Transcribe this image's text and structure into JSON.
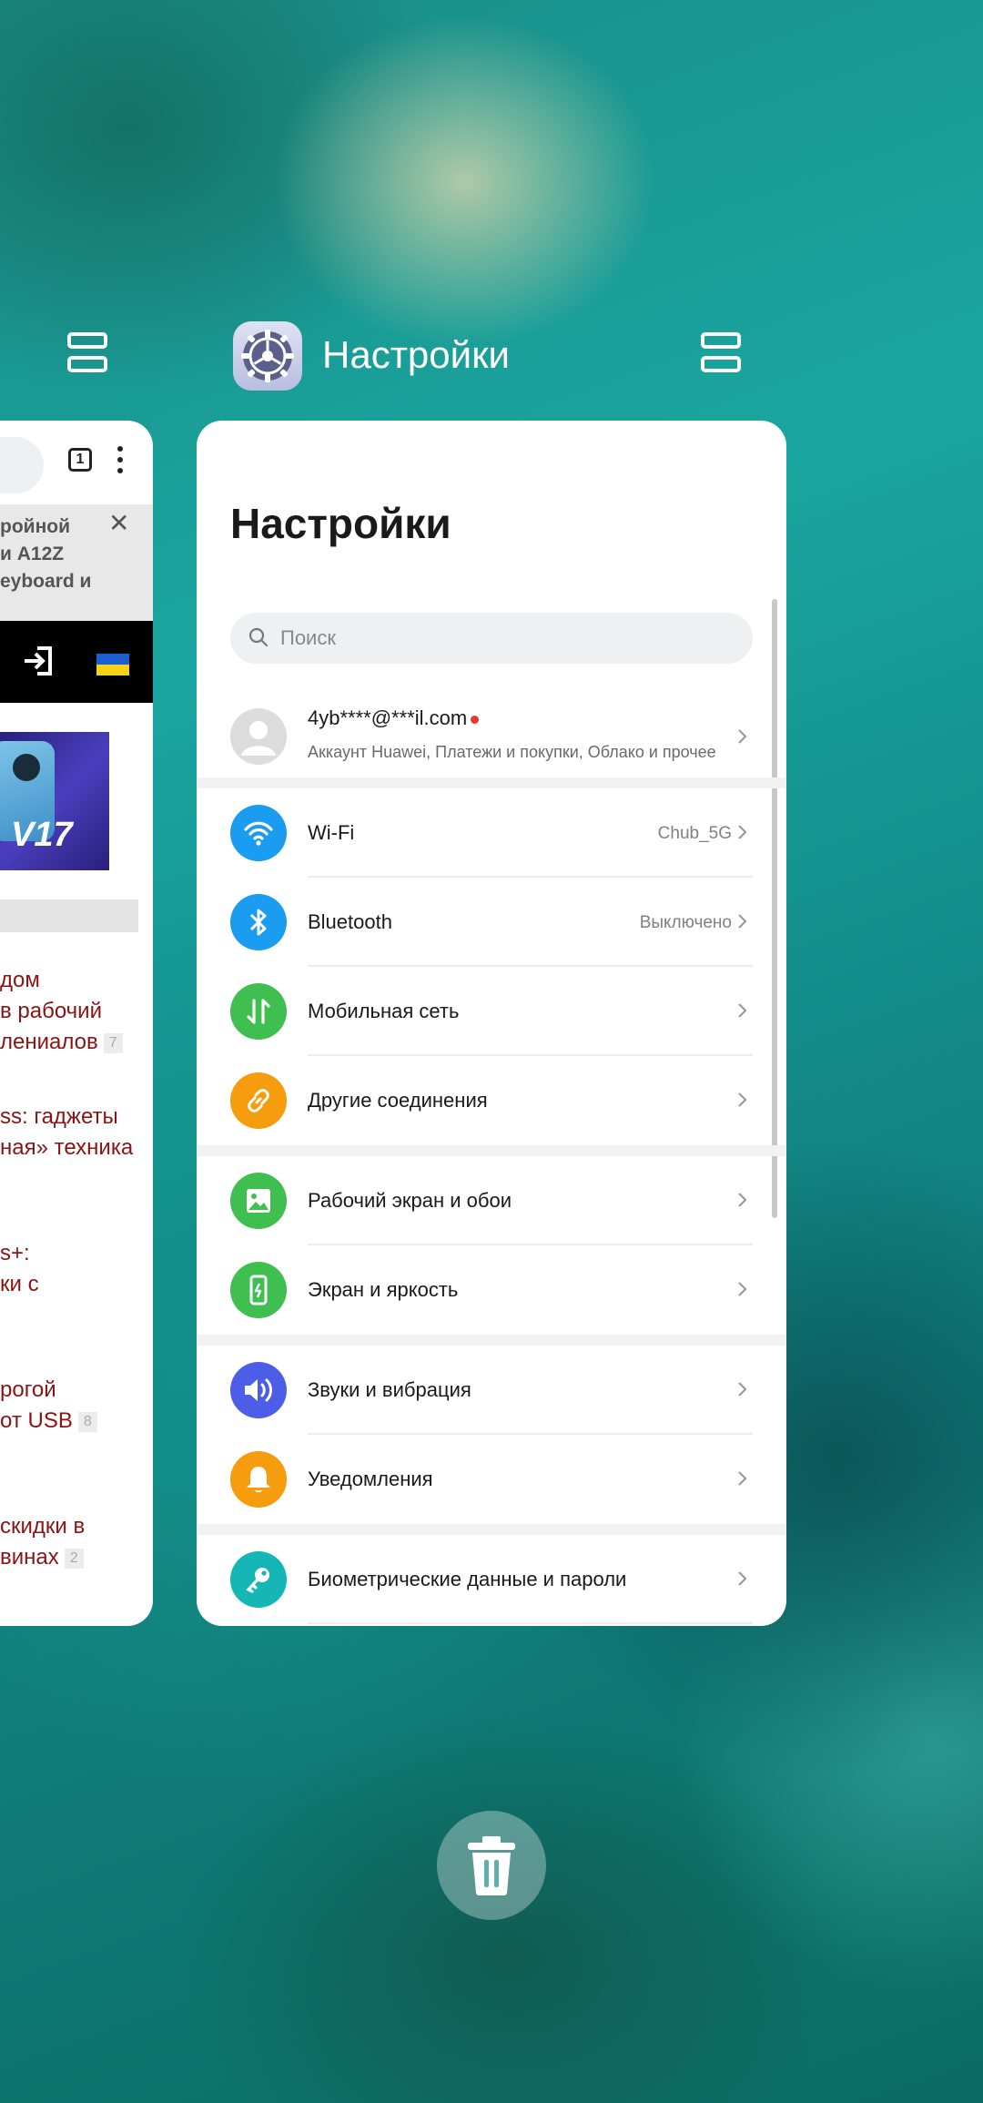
{
  "header": {
    "app_title": "Настройки"
  },
  "browser_card": {
    "tab_count": "1",
    "banner_lines": [
      "ройной",
      "и A12Z",
      "eyboard и"
    ],
    "phone_promo_text": "V17",
    "links": [
      {
        "lines": [
          "дом",
          "в рабочий",
          "лениалов"
        ],
        "count": "7"
      },
      {
        "lines": [
          "ss: гаджеты",
          "ная» техника"
        ],
        "count": ""
      },
      {
        "lines": [
          "s+:",
          "ки с"
        ],
        "count": ""
      },
      {
        "lines": [
          "рогой",
          "от USB"
        ],
        "count": "8"
      },
      {
        "lines": [
          "скидки в",
          "винах"
        ],
        "count": "2"
      }
    ]
  },
  "settings": {
    "page_title": "Настройки",
    "search_placeholder": "Поиск",
    "account": {
      "email": "4yb****@***il.com",
      "subtitle": "Аккаунт Huawei, Платежи и покупки, Облако и прочее"
    },
    "items": [
      {
        "label": "Wi-Fi",
        "value": "Chub_5G",
        "icon": "wifi-icon",
        "color": "#1a9cf0"
      },
      {
        "label": "Bluetooth",
        "value": "Выключено",
        "icon": "bluetooth-icon",
        "color": "#1a9cf0"
      },
      {
        "label": "Мобильная сеть",
        "value": "",
        "icon": "mobile-data-icon",
        "color": "#3fbf4f"
      },
      {
        "label": "Другие соединения",
        "value": "",
        "icon": "link-icon",
        "color": "#f59c0f"
      },
      {
        "label": "Рабочий экран и обои",
        "value": "",
        "icon": "wallpaper-icon",
        "color": "#3fbf4f"
      },
      {
        "label": "Экран и яркость",
        "value": "",
        "icon": "display-icon",
        "color": "#3fbf4f"
      },
      {
        "label": "Звуки и вибрация",
        "value": "",
        "icon": "sound-icon",
        "color": "#4c5ee8"
      },
      {
        "label": "Уведомления",
        "value": "",
        "icon": "bell-icon",
        "color": "#f59c0f"
      },
      {
        "label": "Биометрические данные и пароли",
        "value": "",
        "icon": "key-icon",
        "color": "#16b6b6"
      }
    ]
  }
}
